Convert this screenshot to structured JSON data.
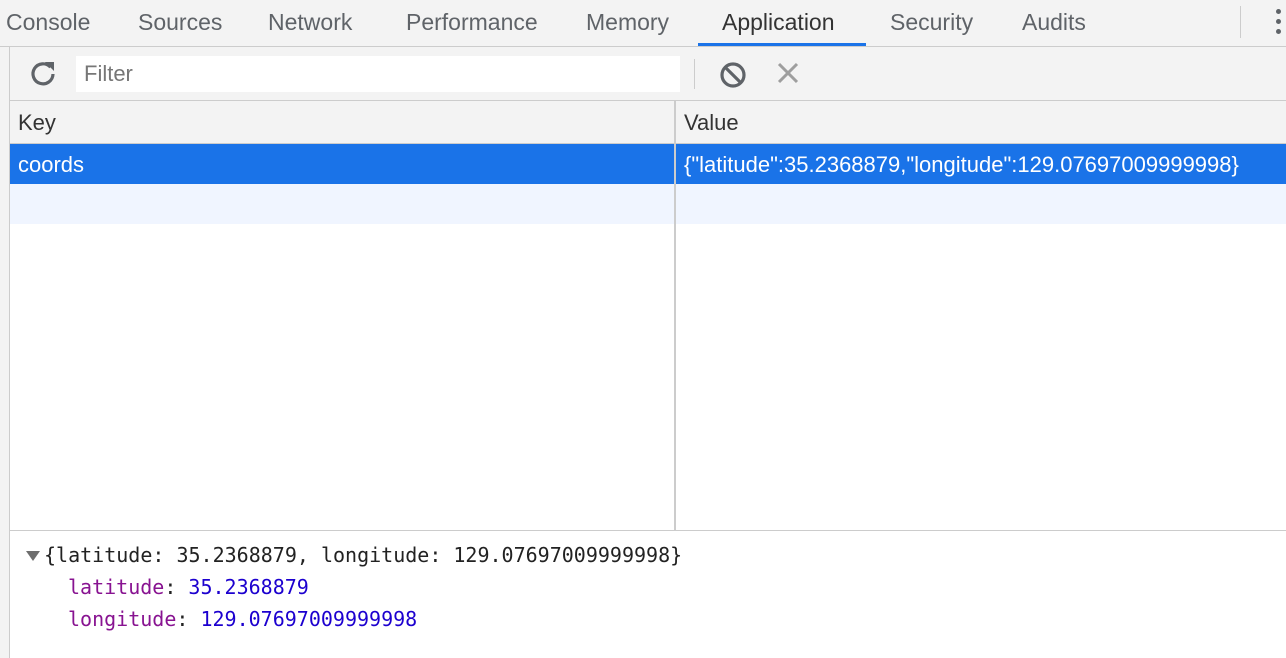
{
  "tabs": {
    "items": [
      {
        "label": "Console"
      },
      {
        "label": "Sources"
      },
      {
        "label": "Network"
      },
      {
        "label": "Performance"
      },
      {
        "label": "Memory"
      },
      {
        "label": "Application"
      },
      {
        "label": "Security"
      },
      {
        "label": "Audits"
      }
    ],
    "active": "Application"
  },
  "toolbar": {
    "filter_placeholder": "Filter",
    "filter_value": "",
    "icons": [
      "refresh-icon",
      "clear-all-icon",
      "delete-selected-icon"
    ]
  },
  "table": {
    "headers": {
      "key": "Key",
      "value": "Value"
    },
    "rows": [
      {
        "key": "coords",
        "value": "{\"latitude\":35.2368879,\"longitude\":129.07697009999998}",
        "selected": true
      }
    ]
  },
  "preview": {
    "summary": "{latitude: 35.2368879, longitude: 129.07697009999998}",
    "properties": [
      {
        "name": "latitude",
        "value": "35.2368879"
      },
      {
        "name": "longitude",
        "value": "129.07697009999998"
      }
    ]
  },
  "colors": {
    "accent": "#1a73e8",
    "selected_row": "#1a73e8",
    "empty_row": "#f0f5ff",
    "property_name": "#881391",
    "number": "#1c00cf"
  }
}
